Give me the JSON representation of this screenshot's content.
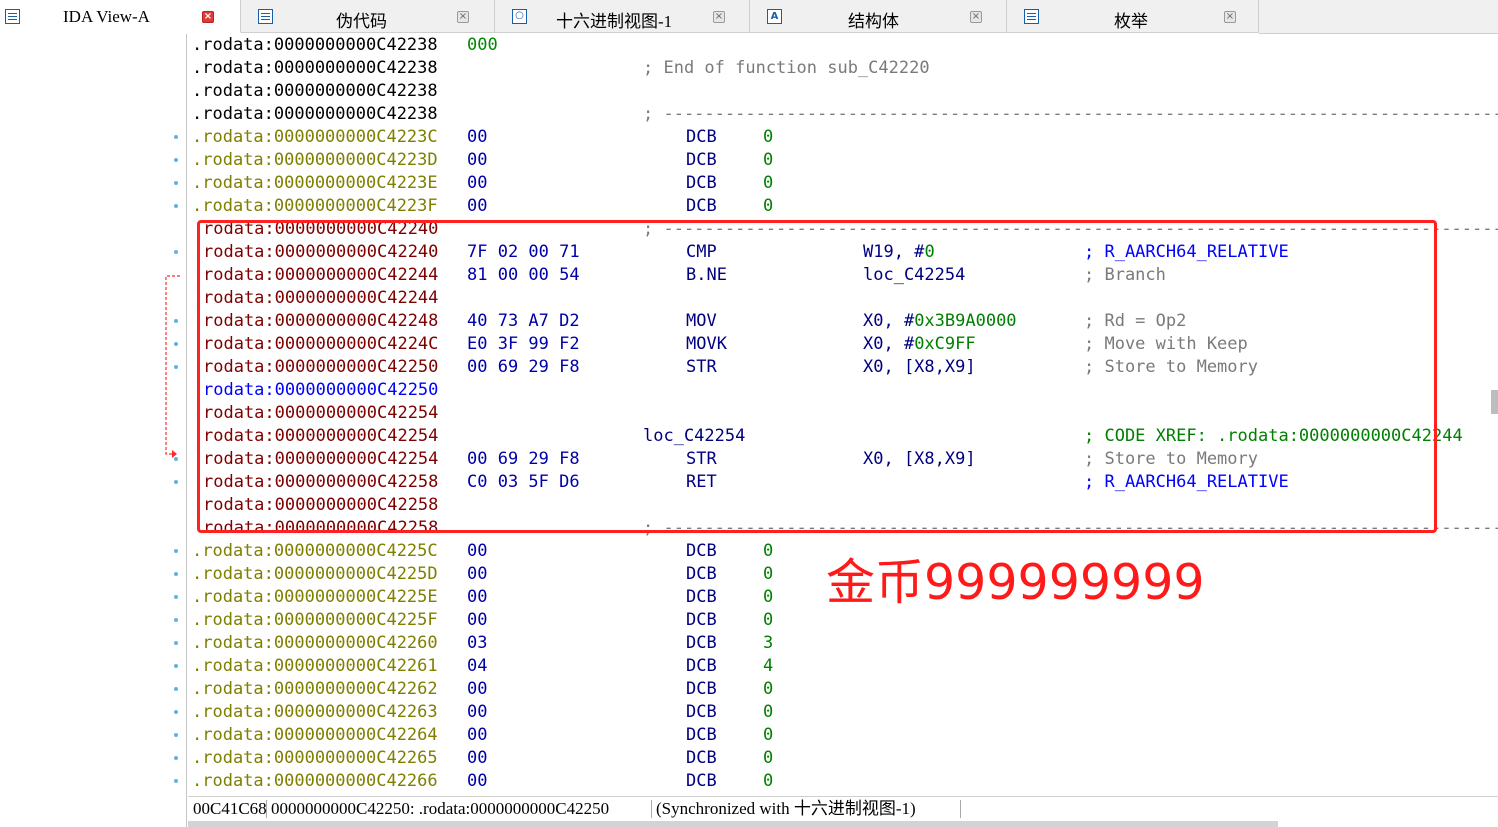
{
  "tabs": [
    {
      "label": "IDA View-A",
      "icon": "ida-view-icon",
      "active": true
    },
    {
      "label": "伪代码",
      "icon": "pseudocode-icon",
      "active": false
    },
    {
      "label": "十六进制视图-1",
      "icon": "hex-view-icon",
      "active": false
    },
    {
      "label": "结构体",
      "icon": "structures-icon",
      "active": false
    },
    {
      "label": "枚举",
      "icon": "enums-icon",
      "active": false
    }
  ],
  "close_glyph": "×",
  "listing": [
    {
      "addr": ".rodata:0000000000C42238",
      "style": "black",
      "bytes": "000",
      "bstyle": "green"
    },
    {
      "addr": ".rodata:0000000000C42238",
      "style": "black",
      "label": "; End of function sub_C42220",
      "lstyle": "cm"
    },
    {
      "addr": ".rodata:0000000000C42238",
      "style": "black"
    },
    {
      "addr": ".rodata:0000000000C42238",
      "style": "black",
      "sep": true
    },
    {
      "addr": ".rodata:0000000000C4223C",
      "style": "olive",
      "bytes": "00",
      "mnem": "DCB",
      "ops": [
        {
          "t": "0",
          "c": "num"
        }
      ],
      "dot": true
    },
    {
      "addr": ".rodata:0000000000C4223D",
      "style": "olive",
      "bytes": "00",
      "mnem": "DCB",
      "ops": [
        {
          "t": "0",
          "c": "num"
        }
      ],
      "dot": true
    },
    {
      "addr": ".rodata:0000000000C4223E",
      "style": "olive",
      "bytes": "00",
      "mnem": "DCB",
      "ops": [
        {
          "t": "0",
          "c": "num"
        }
      ],
      "dot": true
    },
    {
      "addr": ".rodata:0000000000C4223F",
      "style": "olive",
      "bytes": "00",
      "mnem": "DCB",
      "ops": [
        {
          "t": "0",
          "c": "num"
        }
      ],
      "dot": true
    },
    {
      "addr": "rodata:0000000000C42240",
      "style": "maroon",
      "sep": true,
      "indent": true
    },
    {
      "addr": "rodata:0000000000C42240",
      "style": "maroon",
      "bytes": "7F 02 00 71",
      "mnem": "CMP",
      "ops": [
        {
          "t": "W19, #",
          "c": "op"
        },
        {
          "t": "0",
          "c": "num"
        }
      ],
      "wide": true,
      "cmt": "; R_AARCH64_RELATIVE",
      "cstyle": "cmb",
      "indent": true,
      "dot": true
    },
    {
      "addr": "rodata:0000000000C42244",
      "style": "maroon",
      "bytes": "81 00 00 54",
      "mnem": "B.NE",
      "ops": [
        {
          "t": "loc_C42254",
          "c": "op"
        }
      ],
      "wide": true,
      "cmt": "; Branch",
      "cstyle": "cm",
      "indent": true
    },
    {
      "addr": "rodata:0000000000C42244",
      "style": "maroon",
      "indent": true
    },
    {
      "addr": "rodata:0000000000C42248",
      "style": "maroon",
      "bytes": "40 73 A7 D2",
      "mnem": "MOV",
      "ops": [
        {
          "t": "X0, #",
          "c": "op"
        },
        {
          "t": "0x3B9A0000",
          "c": "num"
        }
      ],
      "wide": true,
      "cmt": "; Rd = Op2",
      "cstyle": "cm",
      "indent": true,
      "dot": true
    },
    {
      "addr": "rodata:0000000000C4224C",
      "style": "maroon",
      "bytes": "E0 3F 99 F2",
      "mnem": "MOVK",
      "ops": [
        {
          "t": "X0, #",
          "c": "op"
        },
        {
          "t": "0xC9FF",
          "c": "num"
        }
      ],
      "wide": true,
      "cmt": "; Move with Keep",
      "cstyle": "cm",
      "indent": true,
      "dot": true
    },
    {
      "addr": "rodata:0000000000C42250",
      "style": "maroon",
      "bytes": "00 69 29 F8",
      "mnem": "STR",
      "ops": [
        {
          "t": "X0, [X8,X9]",
          "c": "op"
        }
      ],
      "wide": true,
      "cmt": "; Store to Memory",
      "cstyle": "cm",
      "indent": true,
      "dot": true
    },
    {
      "addr": "rodata:0000000000C42250",
      "style": "blue",
      "indent": true
    },
    {
      "addr": "rodata:0000000000C42254",
      "style": "maroon",
      "indent": true
    },
    {
      "addr": "rodata:0000000000C42254",
      "style": "maroon",
      "label": "loc_C42254",
      "lstyle": "lbl",
      "cmt": "; CODE XREF: .rodata:0000000000C42244",
      "cstyle": "cmg",
      "indent": true
    },
    {
      "addr": "rodata:0000000000C42254",
      "style": "maroon",
      "bytes": "00 69 29 F8",
      "mnem": "STR",
      "ops": [
        {
          "t": "X0, [X8,X9]",
          "c": "op"
        }
      ],
      "wide": true,
      "cmt": "; Store to Memory",
      "cstyle": "cm",
      "indent": true,
      "dot": true
    },
    {
      "addr": "rodata:0000000000C42258",
      "style": "maroon",
      "bytes": "C0 03 5F D6",
      "mnem": "RET",
      "ops": [],
      "wide": true,
      "cmt": "; R_AARCH64_RELATIVE",
      "cstyle": "cmb",
      "indent": true,
      "dot": true
    },
    {
      "addr": "rodata:0000000000C42258",
      "style": "maroon",
      "indent": true
    },
    {
      "addr": "rodata:0000000000C42258",
      "style": "maroon",
      "sep": true,
      "indent": true
    },
    {
      "addr": ".rodata:0000000000C4225C",
      "style": "olive",
      "bytes": "00",
      "mnem": "DCB",
      "ops": [
        {
          "t": "0",
          "c": "num"
        }
      ],
      "dot": true
    },
    {
      "addr": ".rodata:0000000000C4225D",
      "style": "olive",
      "bytes": "00",
      "mnem": "DCB",
      "ops": [
        {
          "t": "0",
          "c": "num"
        }
      ],
      "dot": true
    },
    {
      "addr": ".rodata:0000000000C4225E",
      "style": "olive",
      "bytes": "00",
      "mnem": "DCB",
      "ops": [
        {
          "t": "0",
          "c": "num"
        }
      ],
      "dot": true
    },
    {
      "addr": ".rodata:0000000000C4225F",
      "style": "olive",
      "bytes": "00",
      "mnem": "DCB",
      "ops": [
        {
          "t": "0",
          "c": "num"
        }
      ],
      "dot": true
    },
    {
      "addr": ".rodata:0000000000C42260",
      "style": "olive",
      "bytes": "03",
      "mnem": "DCB",
      "ops": [
        {
          "t": "3",
          "c": "num"
        }
      ],
      "dot": true
    },
    {
      "addr": ".rodata:0000000000C42261",
      "style": "olive",
      "bytes": "04",
      "mnem": "DCB",
      "ops": [
        {
          "t": "4",
          "c": "num"
        }
      ],
      "dot": true
    },
    {
      "addr": ".rodata:0000000000C42262",
      "style": "olive",
      "bytes": "00",
      "mnem": "DCB",
      "ops": [
        {
          "t": "0",
          "c": "num"
        }
      ],
      "dot": true
    },
    {
      "addr": ".rodata:0000000000C42263",
      "style": "olive",
      "bytes": "00",
      "mnem": "DCB",
      "ops": [
        {
          "t": "0",
          "c": "num"
        }
      ],
      "dot": true
    },
    {
      "addr": ".rodata:0000000000C42264",
      "style": "olive",
      "bytes": "00",
      "mnem": "DCB",
      "ops": [
        {
          "t": "0",
          "c": "num"
        }
      ],
      "dot": true
    },
    {
      "addr": ".rodata:0000000000C42265",
      "style": "olive",
      "bytes": "00",
      "mnem": "DCB",
      "ops": [
        {
          "t": "0",
          "c": "num"
        }
      ],
      "dot": true
    },
    {
      "addr": ".rodata:0000000000C42266",
      "style": "olive",
      "bytes": "00",
      "mnem": "DCB",
      "ops": [
        {
          "t": "0",
          "c": "num"
        }
      ],
      "dot": true
    }
  ],
  "annotation": "金币999999999",
  "status": {
    "offset": "00C41C68",
    "location": "0000000000C42250: .rodata:0000000000C42250",
    "sync": "(Synchronized with 十六进制视图-1)"
  },
  "colors": {
    "highlight_box": "#ff2020",
    "annotation_text": "#ff1a1a",
    "address_olive": "#7f7f00",
    "address_maroon": "#7f0000"
  }
}
